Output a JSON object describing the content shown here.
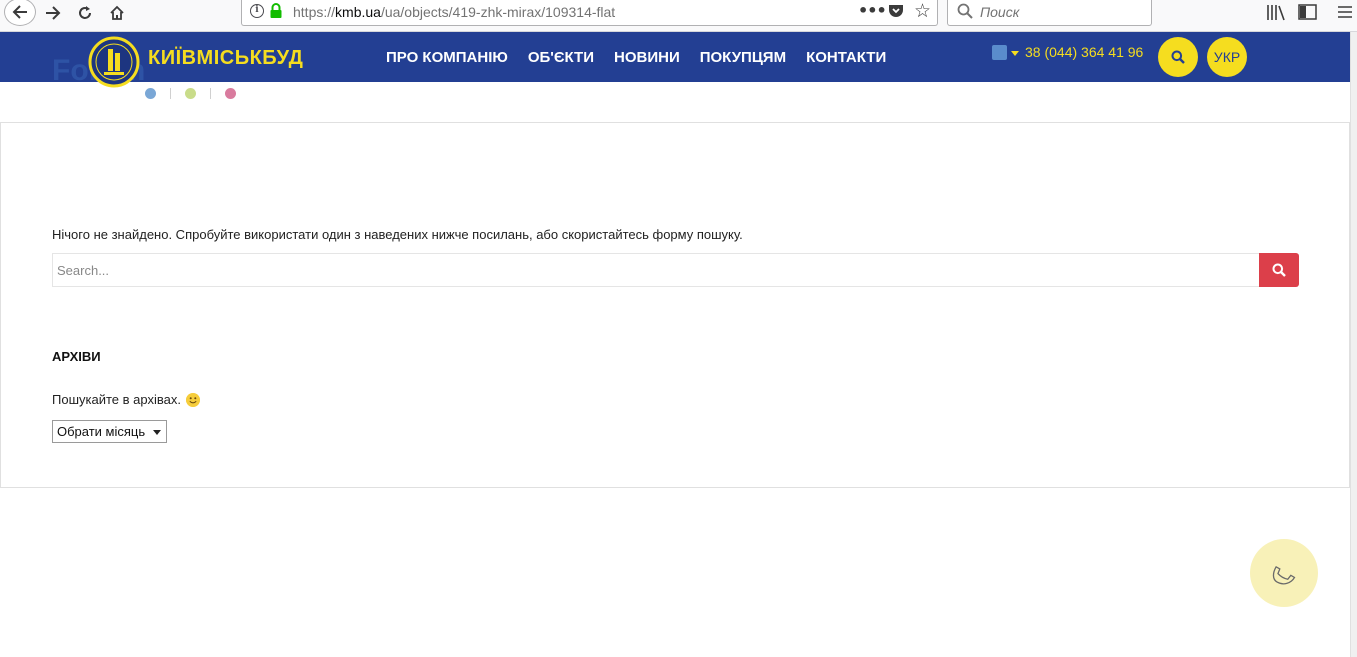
{
  "browser": {
    "url_scheme": "https://",
    "url_host": "kmb.ua",
    "url_path": "/ua/objects/419-zhk-mirax/109314-flat",
    "search_placeholder": "Поиск",
    "more_icon": "•••"
  },
  "site": {
    "logo_text": "КИЇВМІСЬКБУД",
    "nav": [
      "ПРО КОМПАНІЮ",
      "ОБ'ЄКТИ",
      "НОВИНИ",
      "ПОКУПЦЯМ",
      "КОНТАКТИ"
    ],
    "phone": "38 (044) 364 41 96",
    "lang": "УКР"
  },
  "content": {
    "not_found": "Нічого не знайдено. Спробуйте використати один з наведених нижче посилань, або скористайтесь форму пошуку.",
    "search_placeholder": "Search...",
    "archives_title": "АРХІВИ",
    "archives_text": "Пошукайте в архівах.",
    "month_select": "Обрати місяць"
  },
  "colors": {
    "header_bg": "#233f93",
    "accent_yellow": "#f5dd1f",
    "search_button": "#dc3f4a",
    "dot_blue": "#7aa7d6",
    "dot_green": "#c9dc8a",
    "dot_pink": "#d97b9e"
  }
}
